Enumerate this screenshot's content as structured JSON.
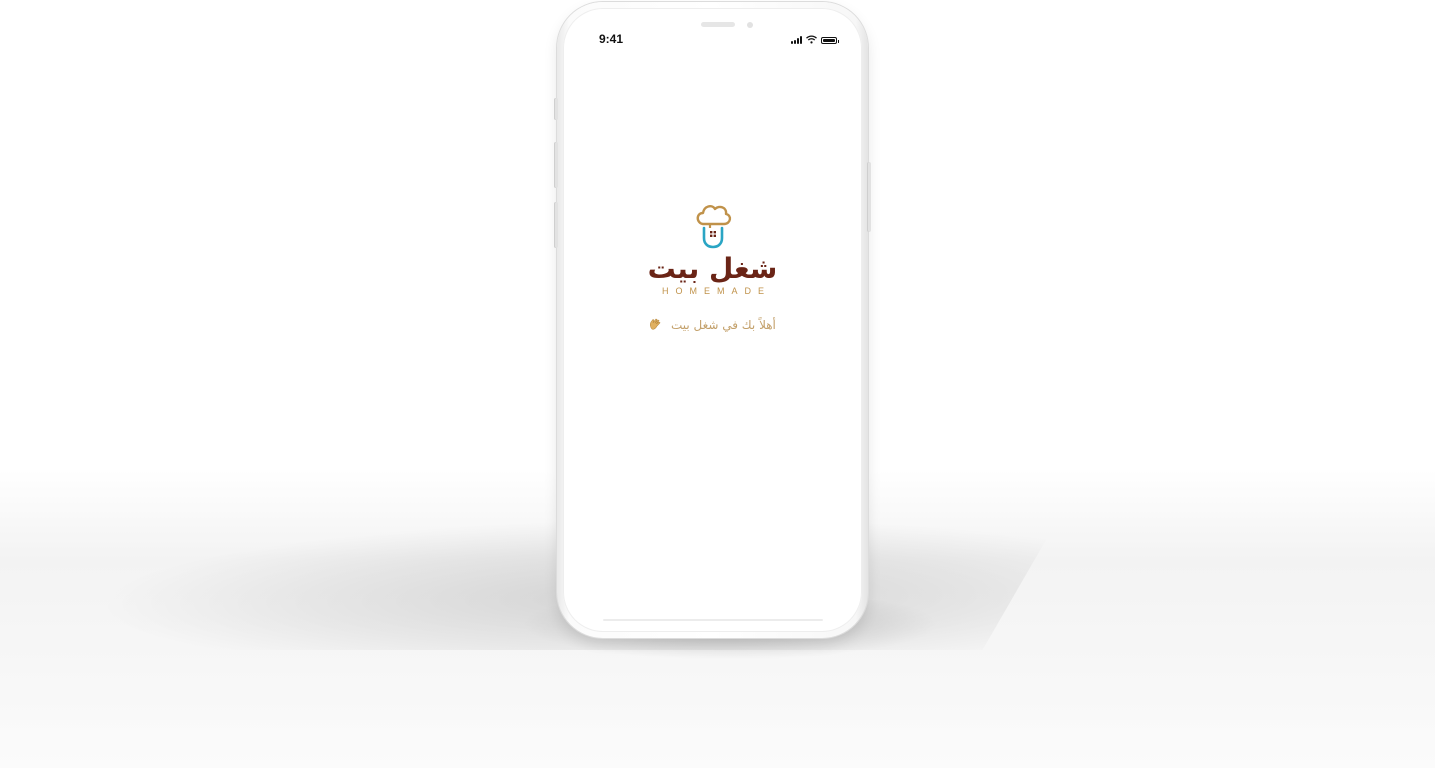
{
  "status_bar": {
    "time": "9:41",
    "signal_icon": "cellular-signal-icon",
    "wifi_icon": "wifi-icon",
    "battery_icon": "battery-icon"
  },
  "splash": {
    "logo_icon": "chef-hat-house-icon",
    "brand_name_ar": "شغل بيت",
    "brand_name_en": "HOMEMADE",
    "welcome_text": "أهلاً بك في شغل بيت",
    "wave_icon": "waving-hand-icon",
    "colors": {
      "brand_brown": "#6a2416",
      "gold": "#c0924a",
      "teal": "#2aa5c4",
      "welcome_text": "#c3a06a"
    }
  }
}
